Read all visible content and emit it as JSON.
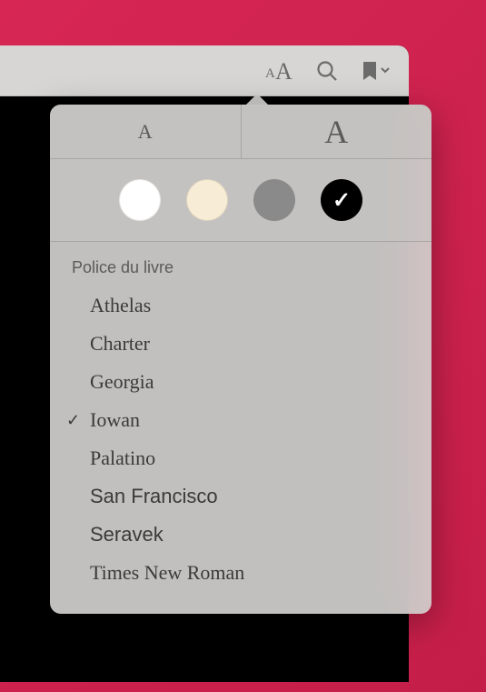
{
  "toolbar": {
    "appearance_icon": "aA",
    "search_icon": "search",
    "bookmark_icon": "bookmark"
  },
  "size_controls": {
    "decrease_label": "A",
    "increase_label": "A"
  },
  "themes": {
    "white": "#ffffff",
    "sepia": "#f7ecd5",
    "gray": "#8a8a8a",
    "black": "#000000",
    "selected": "black"
  },
  "font_section": {
    "header": "Police du livre",
    "fonts": [
      {
        "name": "Athelas",
        "class": "font-athelas",
        "selected": false
      },
      {
        "name": "Charter",
        "class": "font-charter",
        "selected": false
      },
      {
        "name": "Georgia",
        "class": "font-georgia",
        "selected": false
      },
      {
        "name": "Iowan",
        "class": "font-iowan",
        "selected": true
      },
      {
        "name": "Palatino",
        "class": "font-palatino",
        "selected": false
      },
      {
        "name": "San Francisco",
        "class": "font-sanfrancisco",
        "selected": false
      },
      {
        "name": "Seravek",
        "class": "font-seravek",
        "selected": false
      },
      {
        "name": "Times New Roman",
        "class": "font-times",
        "selected": false
      }
    ]
  }
}
